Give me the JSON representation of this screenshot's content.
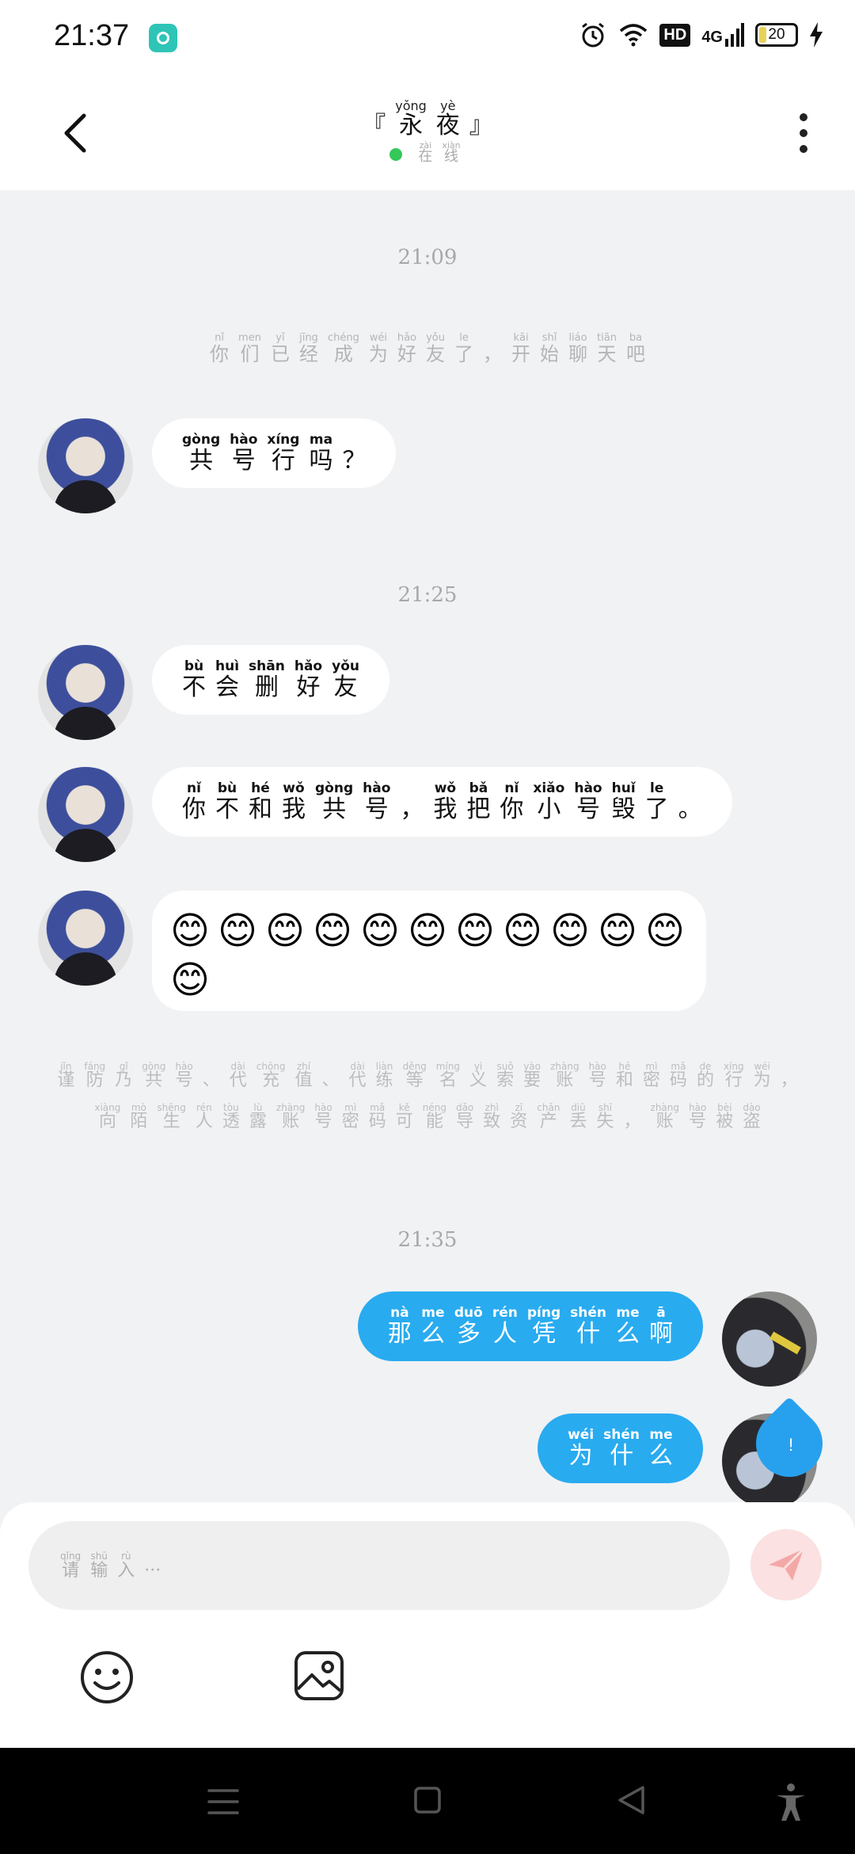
{
  "status_bar": {
    "time": "21:37",
    "network": "4G",
    "hd_badge": "HD",
    "battery_level": "20"
  },
  "header": {
    "title": [
      {
        "py": "",
        "hz": "『"
      },
      {
        "py": "yǒng",
        "hz": "永"
      },
      {
        "py": "yè",
        "hz": "夜"
      },
      {
        "py": "",
        "hz": "』"
      }
    ],
    "status": [
      {
        "py": "zài",
        "hz": "在"
      },
      {
        "py": "xiàn",
        "hz": "线"
      }
    ]
  },
  "chat": {
    "timestamps": [
      "21:09",
      "21:25",
      "21:35"
    ],
    "friend_notice": [
      {
        "py": "nǐ",
        "hz": "你"
      },
      {
        "py": "men",
        "hz": "们"
      },
      {
        "py": "yǐ",
        "hz": "已"
      },
      {
        "py": "jīng",
        "hz": "经"
      },
      {
        "py": "chéng",
        "hz": "成"
      },
      {
        "py": "wéi",
        "hz": "为"
      },
      {
        "py": "hǎo",
        "hz": "好"
      },
      {
        "py": "yǒu",
        "hz": "友"
      },
      {
        "py": "le",
        "hz": "了"
      },
      {
        "py": "",
        "hz": "，"
      },
      {
        "py": "kāi",
        "hz": "开"
      },
      {
        "py": "shǐ",
        "hz": "始"
      },
      {
        "py": "liáo",
        "hz": "聊"
      },
      {
        "py": "tiān",
        "hz": "天"
      },
      {
        "py": "ba",
        "hz": "吧"
      }
    ],
    "messages": {
      "m1": [
        {
          "py": "gòng",
          "hz": "共"
        },
        {
          "py": "hào",
          "hz": "号"
        },
        {
          "py": "xíng",
          "hz": "行"
        },
        {
          "py": "ma",
          "hz": "吗"
        },
        {
          "py": "",
          "hz": "？"
        }
      ],
      "m2": [
        {
          "py": "bù",
          "hz": "不"
        },
        {
          "py": "huì",
          "hz": "会"
        },
        {
          "py": "shān",
          "hz": "删"
        },
        {
          "py": "hǎo",
          "hz": "好"
        },
        {
          "py": "yǒu",
          "hz": "友"
        }
      ],
      "m3": [
        {
          "py": "nǐ",
          "hz": "你"
        },
        {
          "py": "bù",
          "hz": "不"
        },
        {
          "py": "hé",
          "hz": "和"
        },
        {
          "py": "wǒ",
          "hz": "我"
        },
        {
          "py": "gòng",
          "hz": "共"
        },
        {
          "py": "hào",
          "hz": "号"
        },
        {
          "py": "",
          "hz": "，"
        },
        {
          "py": "wǒ",
          "hz": "我"
        },
        {
          "py": "bǎ",
          "hz": "把"
        },
        {
          "py": "nǐ",
          "hz": "你"
        },
        {
          "py": "xiǎo",
          "hz": "小"
        },
        {
          "py": "hào",
          "hz": "号"
        },
        {
          "py": "huǐ",
          "hz": "毁"
        },
        {
          "py": "le",
          "hz": "了"
        },
        {
          "py": "",
          "hz": "。"
        }
      ],
      "m4_emojis": [
        "😊",
        "😊",
        "😊",
        "😊",
        "😊",
        "😊",
        "😊",
        "😊",
        "😊",
        "😊",
        "😊",
        "😊"
      ],
      "m5": [
        {
          "py": "nà",
          "hz": "那"
        },
        {
          "py": "me",
          "hz": "么"
        },
        {
          "py": "duō",
          "hz": "多"
        },
        {
          "py": "rén",
          "hz": "人"
        },
        {
          "py": "píng",
          "hz": "凭"
        },
        {
          "py": "shén",
          "hz": "什"
        },
        {
          "py": "me",
          "hz": "么"
        },
        {
          "py": "ā",
          "hz": "啊"
        }
      ],
      "m6": [
        {
          "py": "wéi",
          "hz": "为"
        },
        {
          "py": "shén",
          "hz": "什"
        },
        {
          "py": "me",
          "hz": "么"
        }
      ]
    },
    "warning_line1": [
      {
        "py": "jǐn",
        "hz": "谨"
      },
      {
        "py": "fáng",
        "hz": "防"
      },
      {
        "py": "gǐ",
        "hz": "乃"
      },
      {
        "py": "gòng",
        "hz": "共"
      },
      {
        "py": "hào",
        "hz": "号"
      },
      {
        "py": "",
        "hz": "、"
      },
      {
        "py": "dài",
        "hz": "代"
      },
      {
        "py": "chōng",
        "hz": "充"
      },
      {
        "py": "zhí",
        "hz": "值"
      },
      {
        "py": "",
        "hz": "、"
      },
      {
        "py": "dài",
        "hz": "代"
      },
      {
        "py": "liàn",
        "hz": "练"
      },
      {
        "py": "děng",
        "hz": "等"
      },
      {
        "py": "míng",
        "hz": "名"
      },
      {
        "py": "yì",
        "hz": "义"
      },
      {
        "py": "suǒ",
        "hz": "索"
      },
      {
        "py": "yào",
        "hz": "要"
      },
      {
        "py": "zhàng",
        "hz": "账"
      },
      {
        "py": "hào",
        "hz": "号"
      },
      {
        "py": "hé",
        "hz": "和"
      },
      {
        "py": "mì",
        "hz": "密"
      },
      {
        "py": "mǎ",
        "hz": "码"
      },
      {
        "py": "de",
        "hz": "的"
      },
      {
        "py": "xíng",
        "hz": "行"
      },
      {
        "py": "wéi",
        "hz": "为"
      },
      {
        "py": "",
        "hz": "，"
      }
    ],
    "warning_line2": [
      {
        "py": "xiàng",
        "hz": "向"
      },
      {
        "py": "mò",
        "hz": "陌"
      },
      {
        "py": "shēng",
        "hz": "生"
      },
      {
        "py": "rén",
        "hz": "人"
      },
      {
        "py": "tòu",
        "hz": "透"
      },
      {
        "py": "lù",
        "hz": "露"
      },
      {
        "py": "zhàng",
        "hz": "账"
      },
      {
        "py": "hào",
        "hz": "号"
      },
      {
        "py": "mì",
        "hz": "密"
      },
      {
        "py": "mǎ",
        "hz": "码"
      },
      {
        "py": "kě",
        "hz": "可"
      },
      {
        "py": "néng",
        "hz": "能"
      },
      {
        "py": "dǎo",
        "hz": "导"
      },
      {
        "py": "zhì",
        "hz": "致"
      },
      {
        "py": "zī",
        "hz": "资"
      },
      {
        "py": "chǎn",
        "hz": "产"
      },
      {
        "py": "diū",
        "hz": "丢"
      },
      {
        "py": "shī",
        "hz": "失"
      },
      {
        "py": "",
        "hz": "，"
      },
      {
        "py": "zhàng",
        "hz": "账"
      },
      {
        "py": "hào",
        "hz": "号"
      },
      {
        "py": "bèi",
        "hz": "被"
      },
      {
        "py": "dào",
        "hz": "盗"
      }
    ],
    "float_badge": "!"
  },
  "composer": {
    "placeholder": [
      {
        "py": "qǐng",
        "hz": "请"
      },
      {
        "py": "shū",
        "hz": "输"
      },
      {
        "py": "rù",
        "hz": "入"
      },
      {
        "py": "",
        "hz": "···"
      }
    ]
  },
  "icons": {
    "back": "chevron-left-icon",
    "more": "more-vertical-icon",
    "send": "paper-plane-icon",
    "emoji": "smiley-icon",
    "image": "image-icon"
  },
  "colors": {
    "outgoing_bubble": "#29abf0",
    "incoming_bubble": "#ffffff",
    "chat_background": "#f1f2f4",
    "online_dot": "#34c759"
  }
}
